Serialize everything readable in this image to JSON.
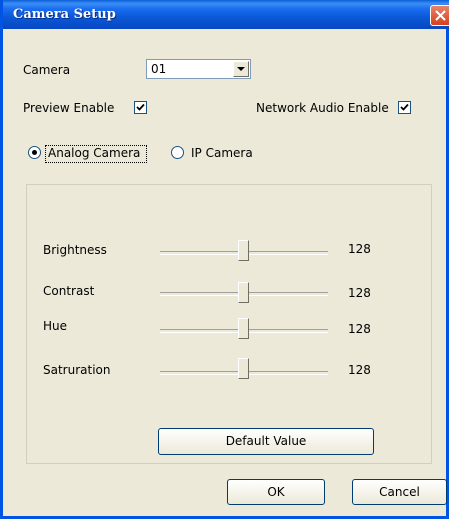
{
  "window": {
    "title": "Camera Setup"
  },
  "camera": {
    "label": "Camera",
    "selected": "01"
  },
  "preview": {
    "label": "Preview Enable",
    "checked": true
  },
  "network_audio": {
    "label": "Network Audio Enable",
    "checked": true
  },
  "camera_type": {
    "analog_label": "Analog Camera",
    "ip_label": "IP Camera",
    "selected": "Analog Camera"
  },
  "sliders": [
    {
      "label": "Brightness",
      "value": "128",
      "level": 0.5
    },
    {
      "label": "Contrast",
      "value": "128",
      "level": 0.5
    },
    {
      "label": "Hue",
      "value": "128",
      "level": 0.5
    },
    {
      "label": "Satruration",
      "value": "128",
      "level": 0.5
    }
  ],
  "buttons": {
    "default_value": "Default Value",
    "ok": "OK",
    "cancel": "Cancel"
  },
  "colors": {
    "titlebar": "#0a58d6",
    "face": "#ece9d8",
    "close": "#d4401c"
  },
  "icons": {
    "close": "close-icon",
    "dropdown": "chevron-down-icon",
    "check": "check-icon"
  }
}
